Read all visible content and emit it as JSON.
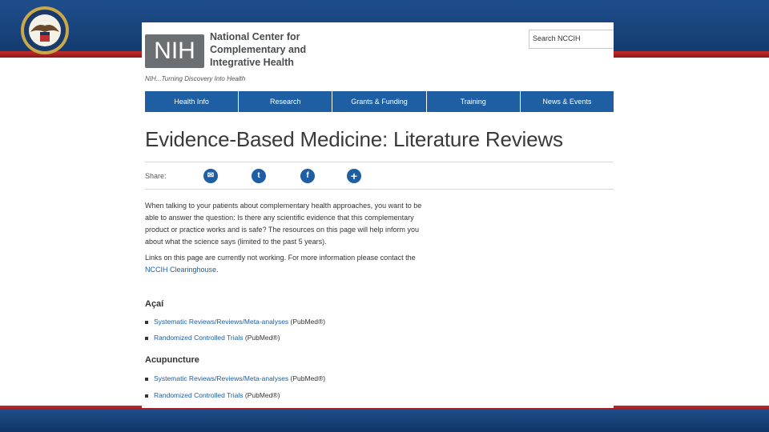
{
  "header": {
    "org_name_lines": [
      "National Center for",
      "Complementary and",
      "Integrative Health"
    ],
    "logo_text": "NIH",
    "tagline": "NIH...Turning Discovery Into Health",
    "search_value": "Search NCCIH"
  },
  "nav": {
    "items": [
      "Health Info",
      "Research",
      "Grants & Funding",
      "Training",
      "News & Events"
    ]
  },
  "page_title": "Evidence-Based Medicine: Literature Reviews",
  "share": {
    "label": "Share:",
    "icons": [
      "email-icon",
      "twitter-icon",
      "facebook-icon",
      "plus-icon"
    ]
  },
  "content": {
    "intro_lines": [
      "When talking to your patients about complementary health approaches, you want to be",
      "able to answer the question: Is there any scientific evidence that this complementary",
      "product or practice works and is safe? The resources on this page will help inform you",
      "about what the science says (limited to the past 5 years)."
    ],
    "notice_text": "Links on this page are currently not working. For more information please contact the",
    "notice_link": "NCCIH Clearinghouse",
    "notice_end": "."
  },
  "sections": [
    {
      "heading": "Açaí",
      "items": [
        {
          "link": "Systematic Reviews/Reviews/Meta-analyses",
          "suffix": " (PubMed®)"
        },
        {
          "link": "Randomized Controlled Trials",
          "suffix": " (PubMed®)"
        }
      ]
    },
    {
      "heading": "Acupuncture",
      "items": [
        {
          "link": "Systematic Reviews/Reviews/Meta-analyses",
          "suffix": " (PubMed®)"
        },
        {
          "link": "Randomized Controlled Trials",
          "suffix": " (PubMed®)"
        }
      ]
    }
  ],
  "colors": {
    "nav_blue": "#1e5ea3",
    "slide_blue": "#1f4e8c",
    "slide_red": "#c42a2a",
    "logo_gray": "#6a6f73"
  }
}
